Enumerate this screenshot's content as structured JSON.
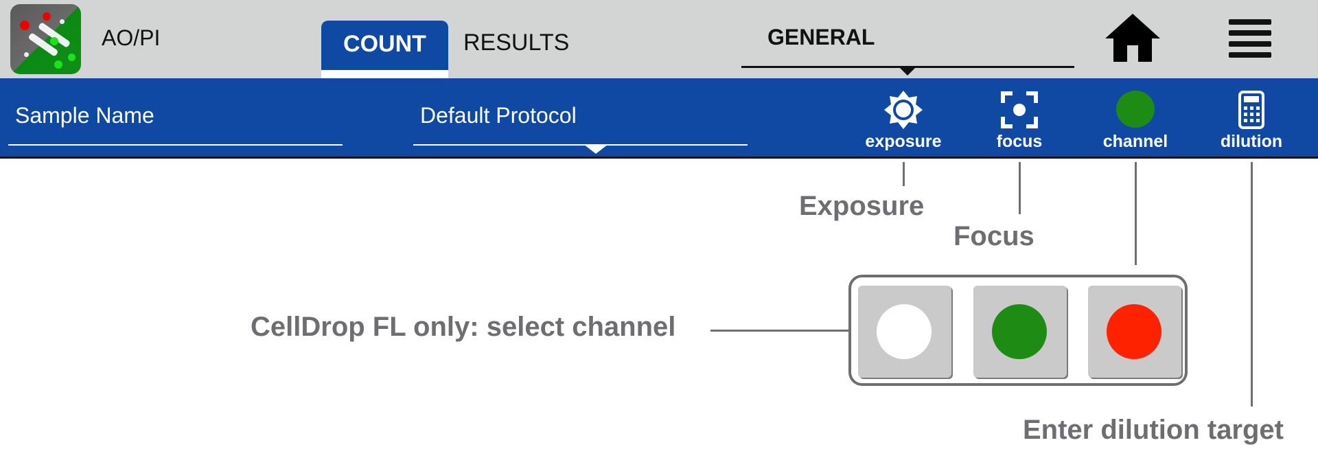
{
  "header": {
    "app_icon": "aopi-cell-icon",
    "app_name": "AO/PI",
    "tabs": [
      {
        "label": "COUNT",
        "active": true
      },
      {
        "label": "RESULTS",
        "active": false
      }
    ],
    "category_dropdown": {
      "value": "GENERAL"
    },
    "home_icon": "home-icon",
    "menu_icon": "hamburger-menu-icon"
  },
  "toolbar": {
    "sample_name": {
      "placeholder": "Sample Name",
      "value": ""
    },
    "protocol": {
      "value": "Default Protocol"
    },
    "tools": [
      {
        "label": "exposure",
        "icon": "brightness-icon"
      },
      {
        "label": "focus",
        "icon": "focus-icon"
      },
      {
        "label": "channel",
        "icon": "channel-dot-icon",
        "color": "#1e8c14"
      },
      {
        "label": "dilution",
        "icon": "calculator-icon"
      }
    ]
  },
  "annotations": {
    "exposure": "Exposure",
    "focus": "Focus",
    "channel": "CellDrop FL only: select channel",
    "dilution": "Enter dilution target"
  },
  "channel_options": [
    {
      "name": "brightfield",
      "color": "#ffffff"
    },
    {
      "name": "green",
      "color": "#1e8c14"
    },
    {
      "name": "red",
      "color": "#ff2200"
    }
  ],
  "colors": {
    "primary_blue": "#0f49a4",
    "header_gray": "#d3d4d4",
    "callout_gray": "#6e6e72"
  }
}
